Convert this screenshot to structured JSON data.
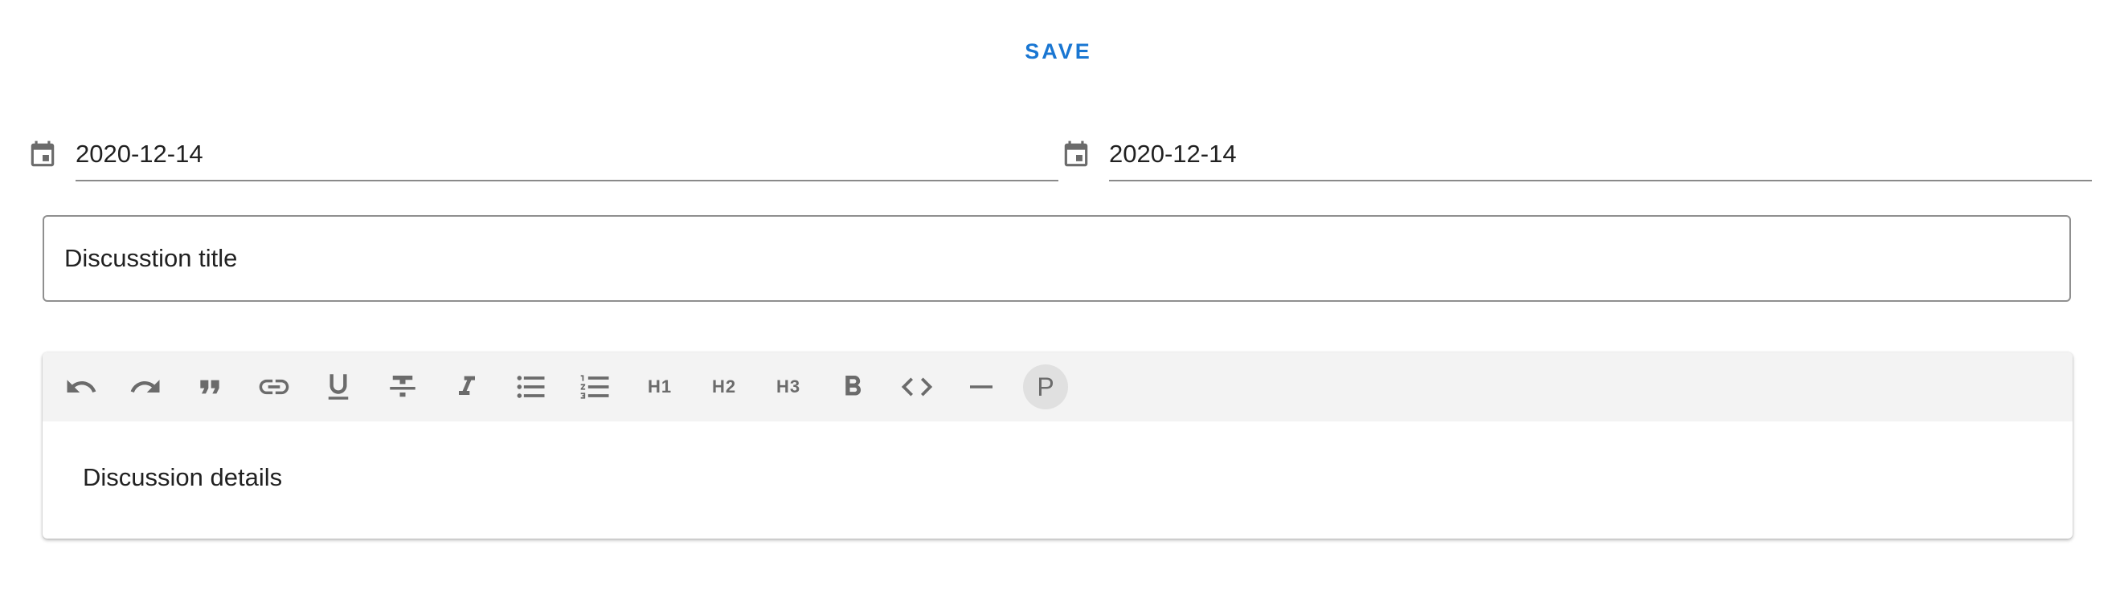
{
  "actions": {
    "save_label": "SAVE"
  },
  "dates": {
    "start": "2020-12-14",
    "end": "2020-12-14"
  },
  "title_field": {
    "placeholder": "Discusstion title"
  },
  "editor": {
    "toolbar": {
      "h1_label": "H1",
      "h2_label": "H2",
      "h3_label": "H3",
      "paragraph_label": "P",
      "active_button": "paragraph"
    },
    "body_placeholder": "Discussion details"
  },
  "colors": {
    "accent": "#1976d2",
    "icon": "#6b6b6b",
    "toolbar_bg": "#f3f3f3"
  }
}
